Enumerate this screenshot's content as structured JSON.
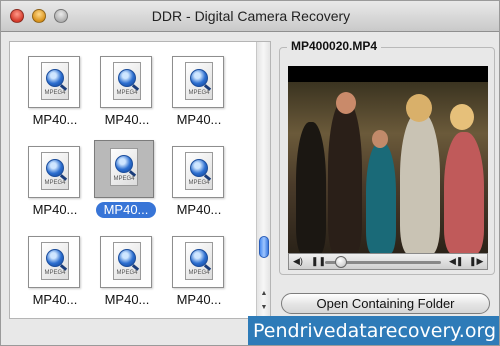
{
  "window": {
    "title": "DDR - Digital Camera Recovery"
  },
  "files": [
    {
      "name": "MP40...",
      "format": "MPEG4",
      "selected": false
    },
    {
      "name": "MP40...",
      "format": "MPEG4",
      "selected": false
    },
    {
      "name": "MP40...",
      "format": "MPEG4",
      "selected": false
    },
    {
      "name": "MP40...",
      "format": "MPEG4",
      "selected": false
    },
    {
      "name": "MP40...",
      "format": "MPEG4",
      "selected": true
    },
    {
      "name": "MP40...",
      "format": "MPEG4",
      "selected": false
    },
    {
      "name": "MP40...",
      "format": "MPEG4",
      "selected": false
    },
    {
      "name": "MP40...",
      "format": "MPEG4",
      "selected": false
    },
    {
      "name": "MP40...",
      "format": "MPEG4",
      "selected": false
    }
  ],
  "preview": {
    "filename": "MP400020.MP4",
    "controls": {
      "volume_icon": "speaker-icon",
      "play_icon": "pause-icon",
      "prev_icon": "step-back-icon",
      "next_icon": "step-forward-icon"
    },
    "playback_position": 0.1
  },
  "buttons": {
    "open_folder": "Open Containing Folder"
  },
  "watermark": "Pendrivedatarecovery.org",
  "colors": {
    "selection": "#3875d7",
    "scroll_thumb": "#4b8cf0",
    "watermark_bg": "#2e7bb8"
  }
}
